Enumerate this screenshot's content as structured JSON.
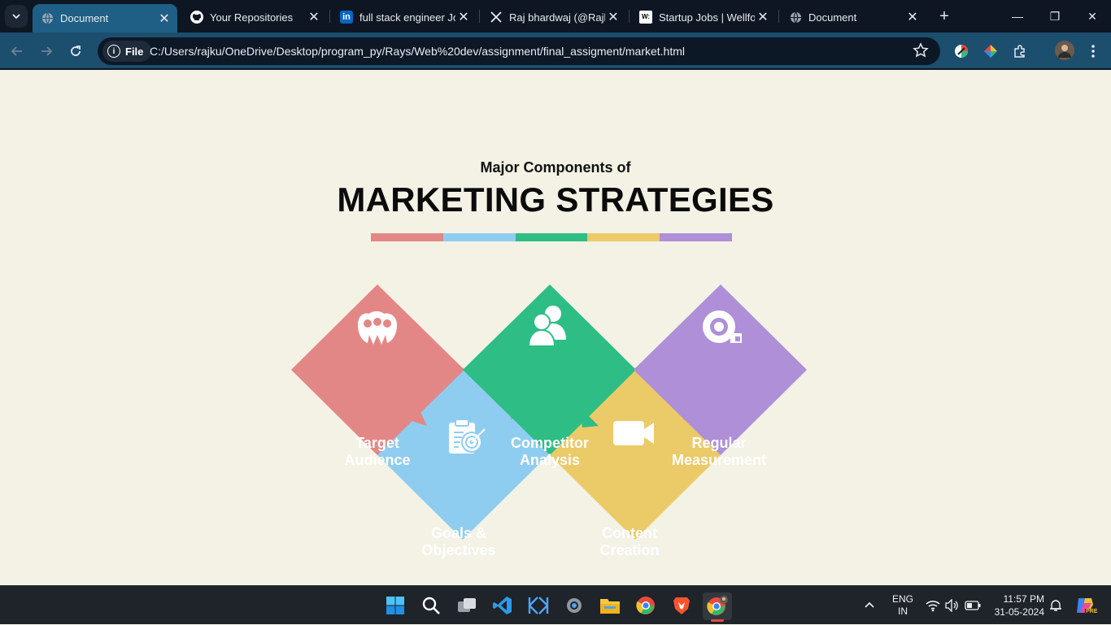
{
  "browser": {
    "tabs": [
      {
        "title": "Document",
        "favicon": "globe-icon",
        "close": "✕"
      },
      {
        "title": "Your Repositories",
        "favicon": "github-icon",
        "close": "✕"
      },
      {
        "title": "full stack engineer Jobs",
        "favicon": "linkedin-icon",
        "close": "✕"
      },
      {
        "title": "Raj bhardwaj (@Rajbh",
        "favicon": "x-icon",
        "close": "✕"
      },
      {
        "title": "Startup Jobs | Wellfound",
        "favicon": "wellfound-icon",
        "close": "✕"
      },
      {
        "title": "Document",
        "favicon": "globe-icon",
        "close": "✕"
      }
    ],
    "new_tab": "+",
    "window_controls": {
      "minimize": "—",
      "restore": "❐",
      "close": "✕"
    },
    "address_chip": "File",
    "url": "C:/Users/rajku/OneDrive/Desktop/program_py/Rays/Web%20dev/assignment/final_assigment/market.html",
    "linkedin_badge": "in",
    "wellfound_badge": "W:"
  },
  "page": {
    "subtitle": "Major Components of",
    "title": "MARKETING STRATEGIES",
    "color_bar": [
      "#e38786",
      "#8fcdf0",
      "#2ebd85",
      "#ebca68",
      "#ae8fd8"
    ],
    "cards": [
      {
        "line1": "Target",
        "line2": "Audience",
        "color": "#e38786",
        "icon": "audience-icon"
      },
      {
        "line1": "Competitor",
        "line2": "Analysis",
        "color": "#2ebd85",
        "icon": "users-icon"
      },
      {
        "line1": "Regular",
        "line2": "Measurement",
        "color": "#ae8fd8",
        "icon": "tape-measure-icon"
      },
      {
        "line1": "Goals &",
        "line2": "Objectives",
        "color": "#8fcdf0",
        "icon": "clipboard-target-icon"
      },
      {
        "line1": "Content",
        "line2": "Creation",
        "color": "#ebca68",
        "icon": "video-camera-icon"
      }
    ]
  },
  "taskbar": {
    "apps": [
      "windows-start-icon",
      "search-icon",
      "task-view-icon",
      "vscode-icon",
      "app-icon",
      "settings-icon",
      "file-explorer-icon",
      "chrome-icon",
      "brave-icon",
      "chrome-profile-icon"
    ],
    "language_line1": "ENG",
    "language_line2": "IN",
    "time": "11:57 PM",
    "date": "31-05-2024",
    "copilot_badge": "PRE"
  }
}
